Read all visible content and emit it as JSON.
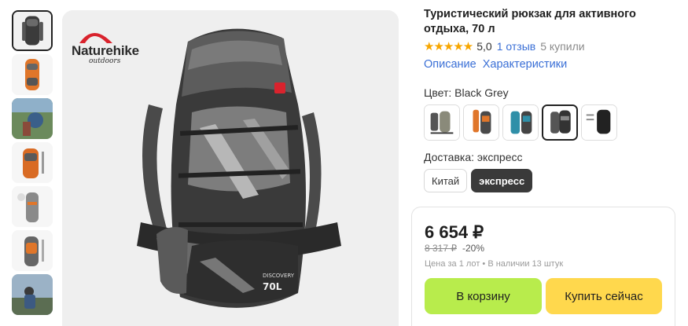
{
  "product": {
    "title": "Туристический рюкзак для активного отдыха, 70 л",
    "brand": "Naturehike",
    "brand_sub": "outdoors",
    "stars": "★★★★★",
    "rating": "5,0",
    "reviews": "1 отзыв",
    "purchases": "5 купили",
    "tabs": [
      "Описание",
      "Характеристики"
    ],
    "image_label_series": "DISCOVERY",
    "image_label_volume": "70L"
  },
  "color": {
    "label": "Цвет: Black Grey",
    "options": [
      "Grey",
      "Orange",
      "Blue",
      "Black Grey",
      "Black"
    ],
    "selected_index": 3
  },
  "delivery": {
    "label": "Доставка: экспресс",
    "options": [
      "Китай",
      "экспресс"
    ],
    "selected_index": 1
  },
  "price": {
    "current": "6 654 ₽",
    "old": "8 317 ₽",
    "discount": "-20%",
    "stock_info": "Цена за 1 лот • В наличии 13 штук"
  },
  "buttons": {
    "cart": "В корзину",
    "buy_now": "Купить сейчас"
  },
  "colors": {
    "accent_link": "#3a6fd6",
    "star": "#f7a600",
    "cart_button": "#b8ec4c",
    "buy_button": "#ffd84d",
    "brand_red": "#d9232d"
  },
  "thumbnails": [
    "backpack-black",
    "backpack-orange",
    "photo-outdoor",
    "backpack-orange-side",
    "backpack-detail",
    "backpack-orange-back",
    "photo-person"
  ]
}
